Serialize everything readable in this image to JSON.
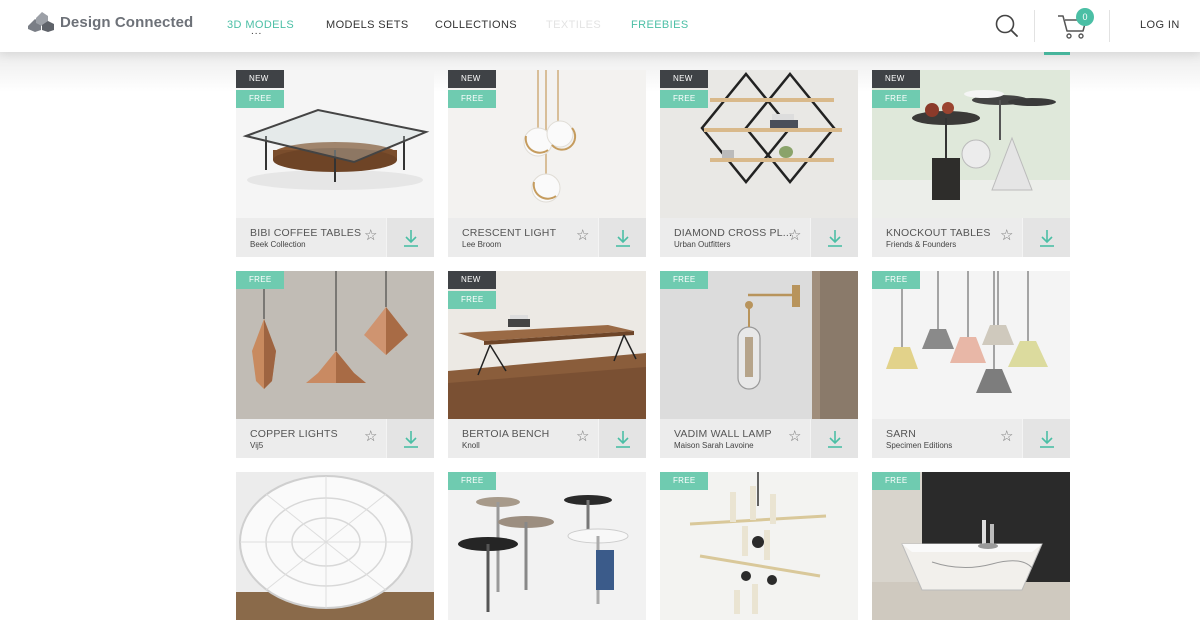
{
  "brand": {
    "name": "Design Connected"
  },
  "nav": {
    "items": [
      {
        "label": "3D MODELS"
      },
      {
        "label": "MODELS SETS"
      },
      {
        "label": "COLLECTIONS"
      },
      {
        "label": "TEXTILES"
      },
      {
        "label": "FREEBIES"
      }
    ],
    "more": "..."
  },
  "header": {
    "search_icon": "search-icon",
    "cart_icon": "cart-icon",
    "cart_count": "0",
    "login_label": "LOG IN"
  },
  "colors": {
    "accent": "#4bbfa5",
    "badge_free": "#6fcbb0",
    "badge_new": "#3f4246"
  },
  "products": [
    {
      "title": "BIBI COFFEE TABLES",
      "brand": "Beek Collection",
      "new": "NEW",
      "free": "FREE"
    },
    {
      "title": "CRESCENT LIGHT",
      "brand": "Lee Broom",
      "new": "NEW",
      "free": "FREE"
    },
    {
      "title": "DIAMOND CROSS PL...",
      "brand": "Urban Outfitters",
      "new": "NEW",
      "free": "FREE"
    },
    {
      "title": "KNOCKOUT TABLES",
      "brand": "Friends & Founders",
      "new": "NEW",
      "free": "FREE"
    },
    {
      "title": "COPPER LIGHTS",
      "brand": "Vij5",
      "free": "FREE"
    },
    {
      "title": "BERTOIA BENCH",
      "brand": "Knoll",
      "new": "NEW",
      "free": "FREE"
    },
    {
      "title": "VADIM WALL LAMP",
      "brand": "Maison Sarah Lavoine",
      "free": "FREE"
    },
    {
      "title": "SARN",
      "brand": "Specimen Editions",
      "free": "FREE"
    },
    {
      "free": ""
    },
    {
      "free": "FREE"
    },
    {
      "free": "FREE"
    },
    {
      "free": "FREE"
    }
  ],
  "card_actions": {
    "favorite_icon": "star-icon",
    "download_icon": "download-icon"
  }
}
